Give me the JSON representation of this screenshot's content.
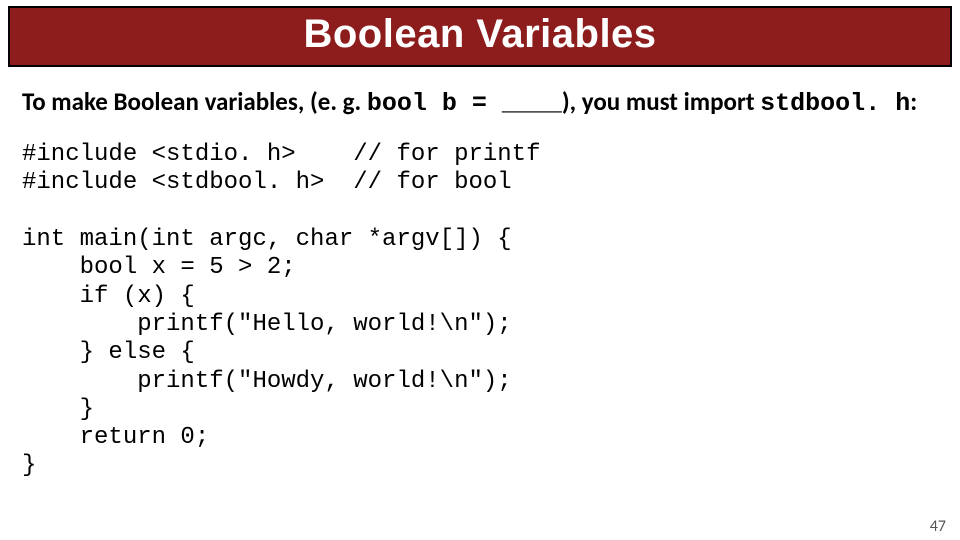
{
  "title": "Boolean Variables",
  "intro": {
    "before": "To make Boolean variables, (e. g. ",
    "code1": "bool b = ____",
    "mid": "), you must import ",
    "code2": "stdbool. h",
    "after": ":"
  },
  "code": "#include <stdio. h>    // for printf\n#include <stdbool. h>  // for bool\n\nint main(int argc, char *argv[]) {\n    bool x = 5 > 2;\n    if (x) {\n        printf(\"Hello, world!\\n\");\n    } else {\n        printf(\"Howdy, world!\\n\");\n    }\n    return 0;\n}",
  "page_number": "47"
}
